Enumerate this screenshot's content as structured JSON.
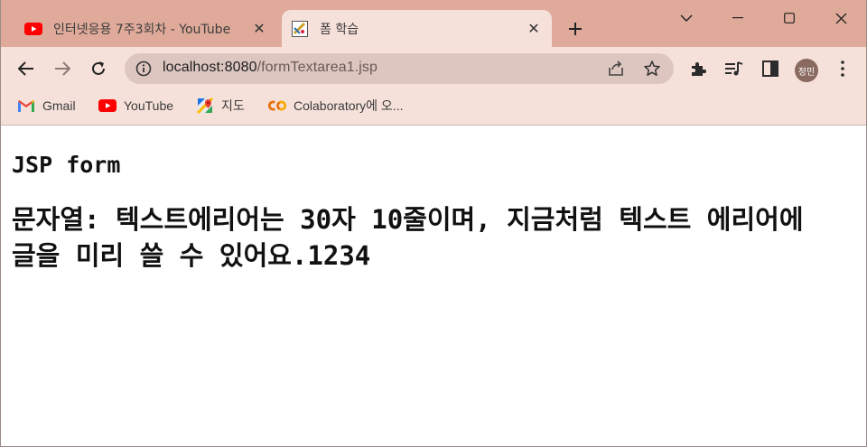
{
  "tabs": [
    {
      "title": "인터넷응용 7주3회차 - YouTube",
      "icon": "youtube-icon",
      "active": false
    },
    {
      "title": "폼 학습",
      "icon": "page-favicon-icon",
      "active": true
    }
  ],
  "toolbar": {
    "url_host": "localhost:8080",
    "url_path": "/formTextarea1.jsp",
    "profile_initials": "정민"
  },
  "bookmarks": [
    {
      "label": "Gmail",
      "icon": "gmail-icon"
    },
    {
      "label": "YouTube",
      "icon": "youtube-icon"
    },
    {
      "label": "지도",
      "icon": "maps-icon"
    },
    {
      "label": "Colaboratory에 오...",
      "icon": "colab-icon"
    }
  ],
  "page": {
    "heading": "JSP form",
    "output_text": "문자열: 텍스트에리어는 30자 10줄이며, 지금처럼 텍스트 에리어에 글을 미리 쓸 수 있어요.1234"
  },
  "colors": {
    "tabstrip_bg": "#dfaa9a",
    "toolbar_bg": "#f6e1da",
    "omnibox_bg": "#dcc6bf",
    "youtube_red": "#ff0000"
  }
}
